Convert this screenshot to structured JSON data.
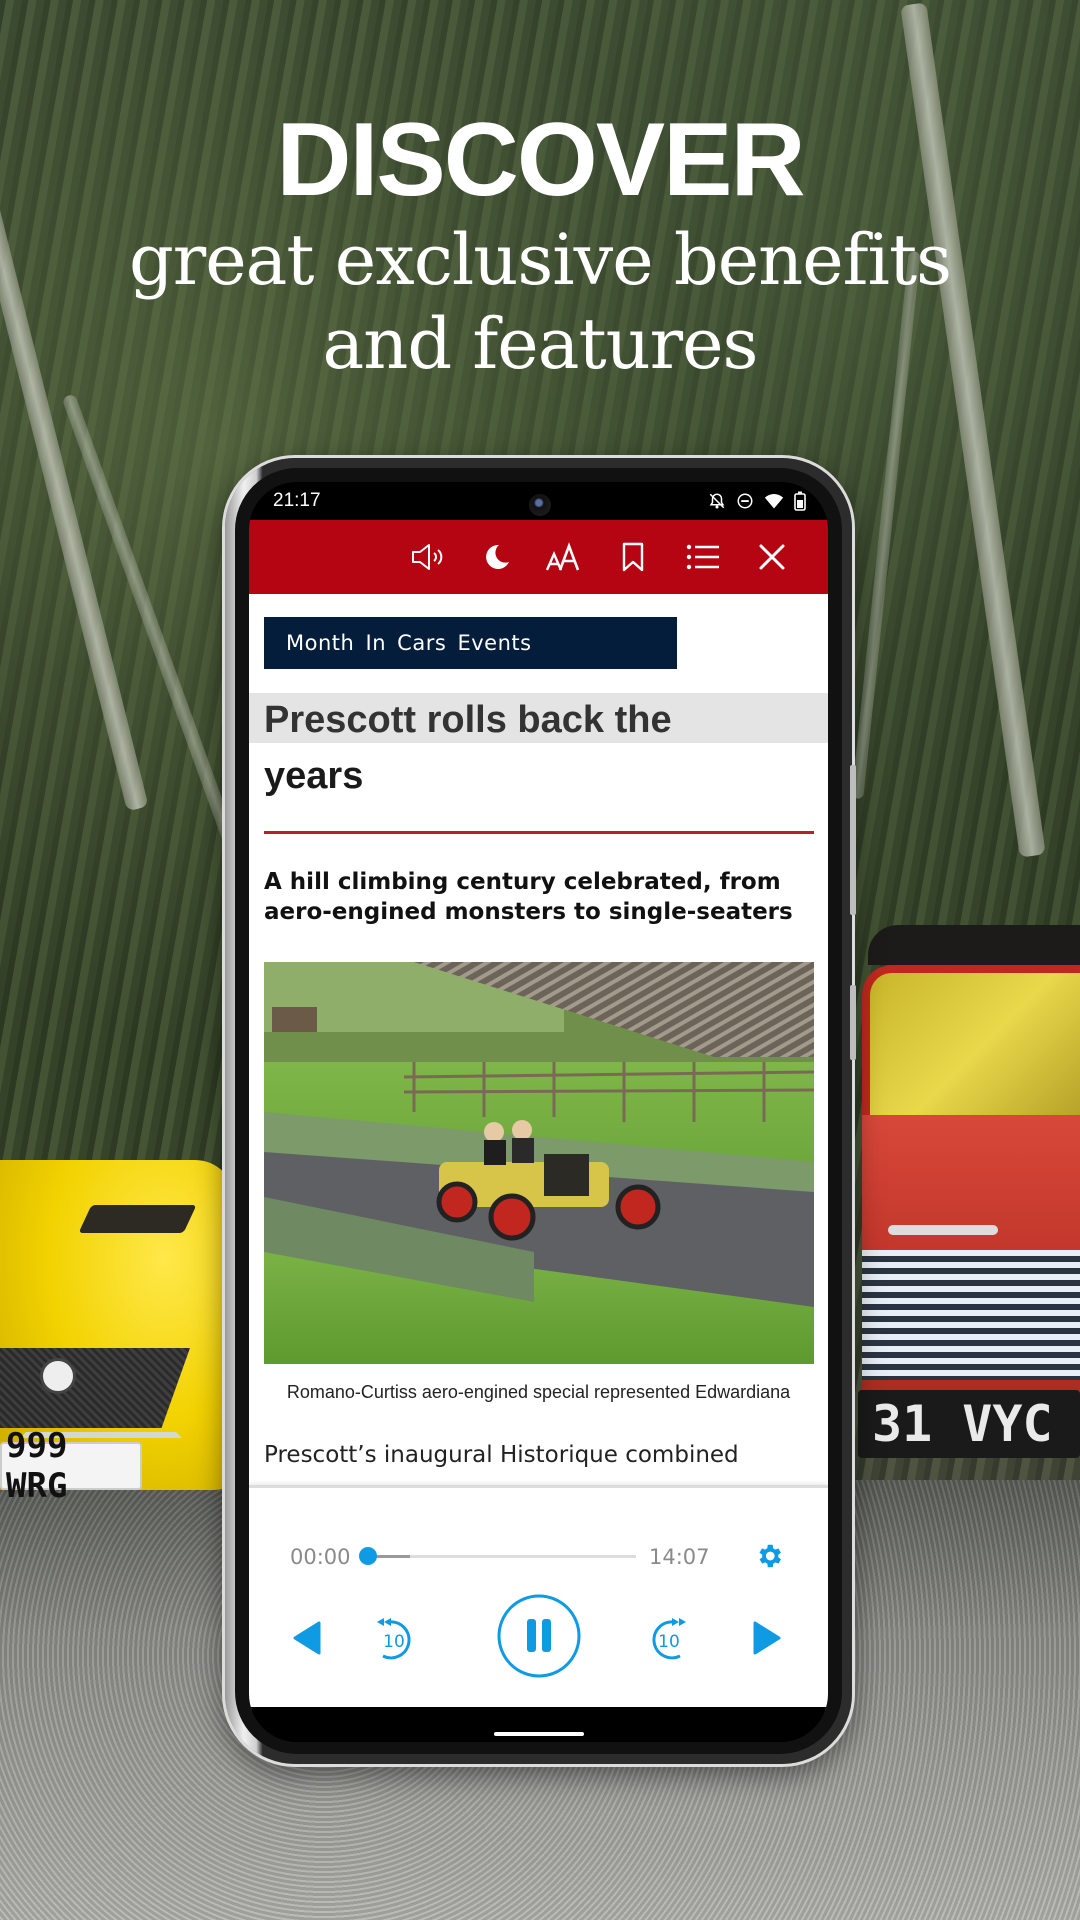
{
  "hero": {
    "title": "DISCOVER",
    "subtitle_line1": "great exclusive benefits",
    "subtitle_line2": "and features"
  },
  "background": {
    "left_car_plate": "999 WRG",
    "right_car_plate": "31 VYC"
  },
  "status_bar": {
    "time": "21:17",
    "icons": [
      "notifications-off-icon",
      "do-not-disturb-icon",
      "wifi-icon",
      "battery-icon"
    ]
  },
  "toolbar": {
    "background_color": "#b60512",
    "buttons": [
      {
        "name": "text-to-speech",
        "icon": "speaker-icon"
      },
      {
        "name": "night-mode",
        "icon": "moon-icon"
      },
      {
        "name": "font-size",
        "icon": "font-size-icon",
        "label": "AA"
      },
      {
        "name": "bookmark",
        "icon": "bookmark-icon"
      },
      {
        "name": "contents",
        "icon": "list-icon"
      },
      {
        "name": "close",
        "icon": "close-icon"
      }
    ]
  },
  "article": {
    "category": "Month In Cars Events",
    "headline_line1": "Prescott rolls back the",
    "headline_line2": "years",
    "standfirst_line1": "A hill climbing century celebrated, from",
    "standfirst_line2": "aero-engined monsters to single-seaters",
    "photo_alt": "Yellow vintage aero-engined racing car with red wheels on a hill climb track",
    "caption": "Romano-Curtiss aero-engined special represented Edwardiana",
    "body_start": "Prescott’s inaugural Historique combined"
  },
  "player": {
    "current_time": "00:00",
    "total_time": "14:07",
    "progress_percent": 0,
    "buffered_percent": 9,
    "accent_color": "#0f9be3",
    "skip_back_label": "10",
    "skip_forward_label": "10",
    "state": "playing"
  }
}
